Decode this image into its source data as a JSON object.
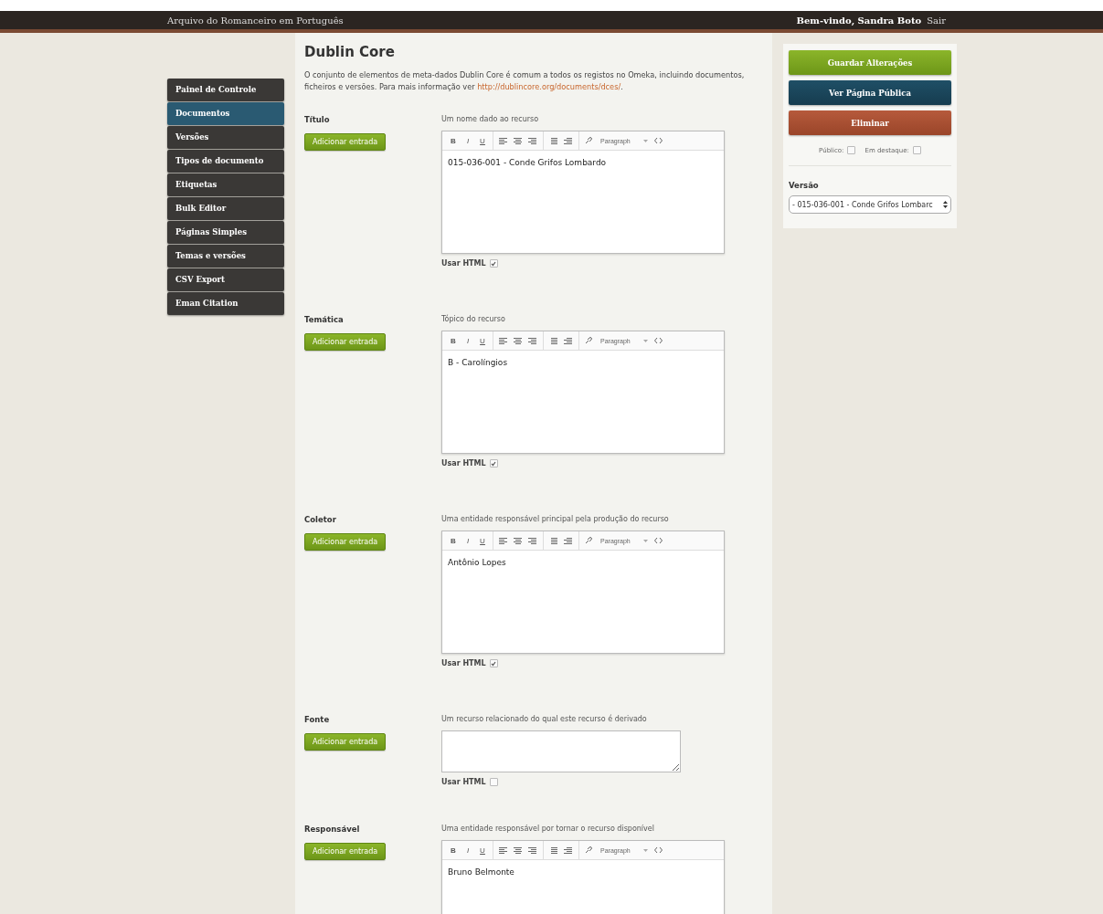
{
  "header": {
    "site_title": "Arquivo do Romanceiro em Português",
    "welcome": "Bem-vindo, Sandra Boto",
    "logout": "Sair"
  },
  "sidebar": {
    "items": [
      {
        "label": "Painel de Controle",
        "selected": false
      },
      {
        "label": "Documentos",
        "selected": true
      },
      {
        "label": "Versões",
        "selected": false
      },
      {
        "label": "Tipos de documento",
        "selected": false
      },
      {
        "label": "Etiquetas",
        "selected": false
      },
      {
        "label": "Bulk Editor",
        "selected": false
      },
      {
        "label": "Páginas Simples",
        "selected": false
      },
      {
        "label": "Temas e versões",
        "selected": false
      },
      {
        "label": "CSV Export",
        "selected": false
      },
      {
        "label": "Eman Citation",
        "selected": false
      }
    ]
  },
  "section": {
    "title": "Dublin Core",
    "description": "O conjunto de elementos de meta-dados Dublin Core é comum a todos os registos no Omeka, incluindo documentos, ficheiros e versões. Para mais informação ver ",
    "link": "http://dublincore.org/documents/dces/",
    "description_end": "."
  },
  "fields": [
    {
      "label": "Título",
      "add_button": "Adicionar entrada",
      "hint": "Um nome dado ao recurso",
      "kind": "rich",
      "toolbar": {
        "bold": "B",
        "italic": "I",
        "underline": "U",
        "format": "Paragraph"
      },
      "value": "015-036-001 - Conde Grifos Lombardo",
      "use_html_label": "Usar HTML",
      "use_html": true
    },
    {
      "label": "Temática",
      "add_button": "Adicionar entrada",
      "hint": "Tópico do recurso",
      "kind": "rich",
      "toolbar": {
        "bold": "B",
        "italic": "I",
        "underline": "U",
        "format": "Paragraph"
      },
      "value": "B - Carolíngios",
      "use_html_label": "Usar HTML",
      "use_html": true
    },
    {
      "label": "Coletor",
      "add_button": "Adicionar entrada",
      "hint": "Uma entidade responsável principal pela produção do recurso",
      "kind": "rich",
      "toolbar": {
        "bold": "B",
        "italic": "I",
        "underline": "U",
        "format": "Paragraph"
      },
      "value": "Antônio Lopes",
      "use_html_label": "Usar HTML",
      "use_html": true
    },
    {
      "label": "Fonte",
      "add_button": "Adicionar entrada",
      "hint": "Um recurso relacionado do qual este recurso é derivado",
      "kind": "plain",
      "use_html_label": "Usar HTML",
      "use_html": false
    },
    {
      "label": "Responsável",
      "add_button": "Adicionar entrada",
      "hint": "Uma entidade responsável por tornar o recurso disponível",
      "kind": "rich",
      "toolbar": {
        "bold": "B",
        "italic": "I",
        "underline": "U",
        "format": "Paragraph"
      },
      "value": "Bruno Belmonte"
    }
  ],
  "actions": {
    "buttons": [
      {
        "label": "Guardar Alterações",
        "kind": "save"
      },
      {
        "label": "Ver Página Pública",
        "kind": "view"
      },
      {
        "label": "Eliminar",
        "kind": "delete"
      }
    ],
    "checkboxes": [
      {
        "label": "Público:",
        "checked": false
      },
      {
        "label": "Em destaque:",
        "checked": false
      }
    ],
    "version_label": "Versão",
    "version_value": "- 015-036-001 - Conde Grifos Lombarc"
  }
}
